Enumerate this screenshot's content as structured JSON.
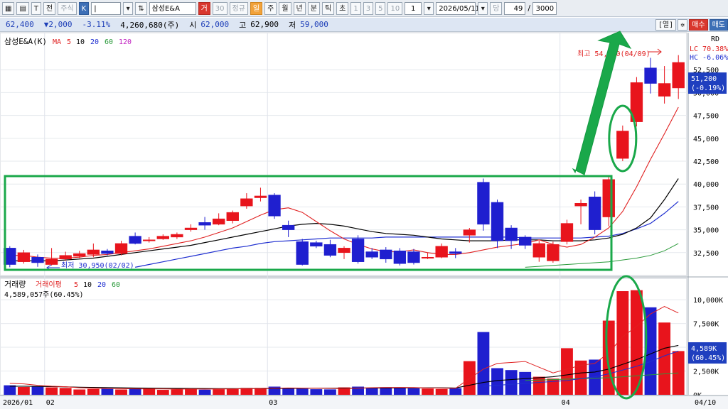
{
  "toolbar": {
    "items": [
      "주식",
      "K",
      "삼성E&A",
      "거",
      "30",
      "정규",
      "일",
      "주",
      "월",
      "년",
      "분",
      "틱",
      "초",
      "1",
      "3",
      "5",
      "10",
      "1",
      "2026/05/11",
      "당",
      "49",
      "/",
      "3000"
    ],
    "window_label": "T",
    "window_label2": "전"
  },
  "infobar": {
    "price": "62,400",
    "change": "▼2,000",
    "change_pct": "-3.11%",
    "volume": "4,260,680(주)",
    "open_label": "시",
    "open": "62,000",
    "high_label": "고",
    "high": "62,900",
    "low_label": "저",
    "low": "59,000",
    "right_label": "[열]",
    "buy_label": "매수",
    "sell_label": "매도"
  },
  "chart_data": [
    {
      "type": "candlestick",
      "title": "삼성E&A(K)",
      "legend": {
        "ma_label": "MA",
        "periods": [
          "5",
          "10",
          "20",
          "60",
          "120"
        ],
        "colors": [
          "#e02020",
          "#000000",
          "#1f2fd0",
          "#2a9a3a",
          "#c020c0"
        ]
      },
      "y_ticks": [
        "52,500",
        "50,000",
        "47,500",
        "45,000",
        "42,500",
        "40,000",
        "37,500",
        "35,000",
        "32,500"
      ],
      "ylim": [
        30000,
        55000
      ],
      "x_labels": [
        "2026/01",
        "02",
        "03",
        "04",
        "04/10"
      ],
      "side_labels": {
        "lc": "LC  70.38%",
        "hc": "HC  -6.06%",
        "price_box": "51,200",
        "price_box_pct": "(-0.19%)",
        "rd": "RD"
      },
      "annotations": {
        "high": "최고 54,600(04/09)",
        "low": "최저 30,950(02/02)"
      },
      "candles": [
        {
          "o": 33000,
          "h": 33200,
          "l": 30900,
          "c": 31200
        },
        {
          "o": 31500,
          "h": 32800,
          "l": 31300,
          "c": 32500
        },
        {
          "o": 32000,
          "h": 32300,
          "l": 30950,
          "c": 31400
        },
        {
          "o": 31200,
          "h": 33000,
          "l": 31100,
          "c": 31800
        },
        {
          "o": 31800,
          "h": 32600,
          "l": 31600,
          "c": 32200
        },
        {
          "o": 32100,
          "h": 32700,
          "l": 31900,
          "c": 32400
        },
        {
          "o": 32300,
          "h": 33500,
          "l": 32000,
          "c": 32800
        },
        {
          "o": 32700,
          "h": 32900,
          "l": 32200,
          "c": 32400
        },
        {
          "o": 32400,
          "h": 33800,
          "l": 32200,
          "c": 33500
        },
        {
          "o": 34300,
          "h": 34700,
          "l": 33400,
          "c": 33500
        },
        {
          "o": 33800,
          "h": 34200,
          "l": 33600,
          "c": 33900
        },
        {
          "o": 34000,
          "h": 34500,
          "l": 33900,
          "c": 34300
        },
        {
          "o": 34200,
          "h": 34700,
          "l": 34000,
          "c": 34500
        },
        {
          "o": 35000,
          "h": 35600,
          "l": 34800,
          "c": 35200
        },
        {
          "o": 35800,
          "h": 36400,
          "l": 35000,
          "c": 35500
        },
        {
          "o": 35600,
          "h": 36800,
          "l": 35500,
          "c": 36200
        },
        {
          "o": 36000,
          "h": 37100,
          "l": 35700,
          "c": 36900
        },
        {
          "o": 37600,
          "h": 39000,
          "l": 37300,
          "c": 38400
        },
        {
          "o": 38500,
          "h": 39600,
          "l": 38100,
          "c": 38700
        },
        {
          "o": 38800,
          "h": 39000,
          "l": 36200,
          "c": 36500
        },
        {
          "o": 35500,
          "h": 36000,
          "l": 34200,
          "c": 35000
        },
        {
          "o": 33700,
          "h": 34000,
          "l": 31100,
          "c": 31200
        },
        {
          "o": 33600,
          "h": 33800,
          "l": 33000,
          "c": 33200
        },
        {
          "o": 33400,
          "h": 33900,
          "l": 32000,
          "c": 32200
        },
        {
          "o": 32500,
          "h": 33200,
          "l": 31800,
          "c": 33000
        },
        {
          "o": 34000,
          "h": 34400,
          "l": 31300,
          "c": 31500
        },
        {
          "o": 32600,
          "h": 33000,
          "l": 31800,
          "c": 32000
        },
        {
          "o": 32800,
          "h": 33100,
          "l": 31400,
          "c": 31800
        },
        {
          "o": 32700,
          "h": 33000,
          "l": 31100,
          "c": 31300
        },
        {
          "o": 32600,
          "h": 32900,
          "l": 31200,
          "c": 31400
        },
        {
          "o": 31900,
          "h": 32500,
          "l": 31800,
          "c": 32000
        },
        {
          "o": 32000,
          "h": 33500,
          "l": 31900,
          "c": 33200
        },
        {
          "o": 32600,
          "h": 33000,
          "l": 31900,
          "c": 32400
        },
        {
          "o": 34400,
          "h": 35200,
          "l": 33600,
          "c": 35000
        },
        {
          "o": 40200,
          "h": 40600,
          "l": 34900,
          "c": 35600
        },
        {
          "o": 38000,
          "h": 38300,
          "l": 33000,
          "c": 33800
        },
        {
          "o": 35200,
          "h": 35500,
          "l": 32900,
          "c": 33800
        },
        {
          "o": 34200,
          "h": 34400,
          "l": 32900,
          "c": 33300
        },
        {
          "o": 32000,
          "h": 33800,
          "l": 31500,
          "c": 33500
        },
        {
          "o": 31600,
          "h": 33700,
          "l": 31400,
          "c": 33400
        },
        {
          "o": 33700,
          "h": 36100,
          "l": 33400,
          "c": 35700
        },
        {
          "o": 37600,
          "h": 38300,
          "l": 35600,
          "c": 37900
        },
        {
          "o": 38600,
          "h": 39200,
          "l": 34500,
          "c": 35000
        },
        {
          "o": 36400,
          "h": 40900,
          "l": 35400,
          "c": 40500
        },
        {
          "o": 42800,
          "h": 46400,
          "l": 42500,
          "c": 45800
        },
        {
          "o": 46800,
          "h": 51700,
          "l": 46300,
          "c": 51100
        },
        {
          "o": 52700,
          "h": 53800,
          "l": 49900,
          "c": 51000
        },
        {
          "o": 49600,
          "h": 52900,
          "l": 48800,
          "c": 51000
        },
        {
          "o": 50500,
          "h": 54100,
          "l": 49300,
          "c": 53300
        }
      ],
      "ma5": [
        32200,
        32200,
        32000,
        31900,
        31900,
        32000,
        32200,
        32300,
        32500,
        32700,
        32900,
        33200,
        33500,
        33800,
        34200,
        34700,
        35200,
        35900,
        36600,
        37200,
        37400,
        36900,
        35900,
        34900,
        34000,
        33400,
        32900,
        32600,
        32600,
        32800,
        32500,
        32300,
        32300,
        32500,
        32800,
        33100,
        33300,
        33500,
        33900,
        33400,
        33100,
        33400,
        34200,
        35200,
        37000,
        39700,
        42700,
        45500,
        48400
      ],
      "ma20": [
        31600,
        31600,
        31600,
        31600,
        31700,
        31800,
        31900,
        32100,
        32300,
        32500,
        32700,
        32900,
        33100,
        33300,
        33600,
        33900,
        34200,
        34500,
        34800,
        35100,
        35400,
        35600,
        35700,
        35600,
        35400,
        35100,
        34800,
        34600,
        34500,
        34400,
        34200,
        34000,
        33900,
        33800,
        33800,
        33800,
        33900,
        33900,
        33900,
        33800,
        33800,
        33800,
        33900,
        34100,
        34500,
        35200,
        36300,
        38300,
        40600
      ],
      "ma60": [
        null,
        null,
        null,
        null,
        null,
        null,
        null,
        null,
        null,
        30900,
        31200,
        31500,
        31800,
        32100,
        32400,
        32700,
        33000,
        33200,
        33500,
        33700,
        33800,
        33900,
        34000,
        34100,
        34100,
        34100,
        34100,
        34200,
        34200,
        34200,
        34200,
        34200,
        34200,
        34200,
        34200,
        34200,
        34200,
        34100,
        34100,
        34100,
        34100,
        34100,
        34200,
        34300,
        34600,
        35100,
        35700,
        36800,
        38100
      ],
      "ma120": [
        null,
        null,
        null,
        null,
        null,
        null,
        null,
        null,
        null,
        null,
        null,
        null,
        null,
        null,
        null,
        null,
        null,
        null,
        null,
        null,
        null,
        null,
        null,
        null,
        null,
        null,
        null,
        null,
        null,
        null,
        null,
        null,
        null,
        null,
        null,
        null,
        null,
        30900,
        31000,
        31100,
        31200,
        31300,
        31400,
        31500,
        31700,
        31900,
        32200,
        32700,
        33500
      ]
    },
    {
      "type": "bar",
      "title": "거래량",
      "legend": {
        "avg_label": "거래이평",
        "periods": [
          "5",
          "10",
          "20",
          "60"
        ],
        "colors": [
          "#e02020",
          "#000000",
          "#1f2fd0",
          "#2a9a3a"
        ]
      },
      "subtitle": "4,589,057주(60.45%)",
      "y_ticks": [
        "10,000K",
        "7,500K",
        "5,000K",
        "2,500K",
        "0K"
      ],
      "ylim": [
        0,
        11500
      ],
      "side_labels": {
        "box": "4,589K",
        "box_pct": "(60.45%)"
      },
      "values": [
        1000,
        820,
        900,
        780,
        720,
        560,
        620,
        680,
        560,
        690,
        680,
        520,
        560,
        680,
        540,
        590,
        620,
        720,
        720,
        860,
        740,
        640,
        590,
        570,
        780,
        860,
        740,
        800,
        720,
        690,
        650,
        610,
        700,
        3540,
        6600,
        2800,
        2600,
        2400,
        1900,
        1700,
        4900,
        3600,
        3700,
        7800,
        10900,
        11000,
        9200,
        7600,
        4600
      ],
      "ma5": [
        1200,
        1150,
        1000,
        900,
        850,
        740,
        700,
        650,
        640,
        630,
        620,
        610,
        600,
        610,
        600,
        610,
        620,
        640,
        670,
        700,
        720,
        710,
        700,
        680,
        660,
        700,
        750,
        760,
        780,
        770,
        720,
        700,
        680,
        1700,
        2700,
        3300,
        3400,
        3500,
        2900,
        2300,
        2700,
        3100,
        3300,
        4400,
        6100,
        7200,
        8500,
        9300,
        8600
      ],
      "ma20": [
        900,
        900,
        880,
        860,
        840,
        800,
        780,
        760,
        740,
        720,
        700,
        690,
        680,
        670,
        660,
        650,
        650,
        650,
        660,
        670,
        680,
        690,
        700,
        700,
        700,
        710,
        720,
        720,
        730,
        730,
        730,
        730,
        720,
        1000,
        1300,
        1500,
        1600,
        1700,
        1800,
        1900,
        2100,
        2300,
        2400,
        2700,
        3200,
        3700,
        4300,
        4900,
        5200
      ],
      "ma60": [
        null,
        null,
        null,
        null,
        null,
        null,
        null,
        null,
        null,
        null,
        null,
        null,
        null,
        null,
        null,
        null,
        null,
        null,
        null,
        null,
        null,
        null,
        null,
        null,
        null,
        null,
        null,
        null,
        null,
        null,
        null,
        null,
        null,
        null,
        null,
        null,
        null,
        1500,
        1550,
        1600,
        1650,
        1700,
        1750,
        1800,
        1900,
        2000,
        2100,
        2200,
        2300
      ],
      "ma_blue_long": [
        null,
        null,
        null,
        null,
        null,
        null,
        null,
        null,
        null,
        null,
        null,
        null,
        null,
        null,
        null,
        null,
        null,
        null,
        null,
        null,
        null,
        null,
        null,
        null,
        null,
        null,
        null,
        null,
        null,
        null,
        null,
        null,
        null,
        null,
        900,
        1000,
        1100,
        1200,
        1300,
        1400,
        1500,
        1700,
        1900,
        2200,
        2600,
        3000,
        3500,
        4100,
        4600
      ]
    }
  ]
}
